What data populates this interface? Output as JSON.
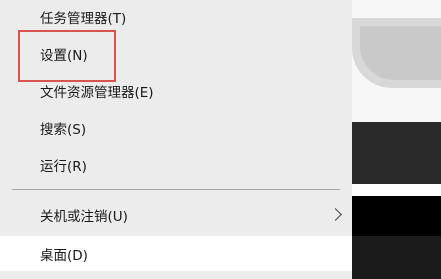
{
  "context_menu": {
    "items": [
      {
        "label": "任务管理器(T)"
      },
      {
        "label": "设置(N)"
      },
      {
        "label": "文件资源管理器(E)"
      },
      {
        "label": "搜索(S)"
      },
      {
        "label": "运行(R)"
      },
      {
        "label": "关机或注销(U)",
        "submenu": true
      },
      {
        "label": "桌面(D)",
        "hovered": true
      }
    ],
    "highlight_color": "#d9534f"
  }
}
